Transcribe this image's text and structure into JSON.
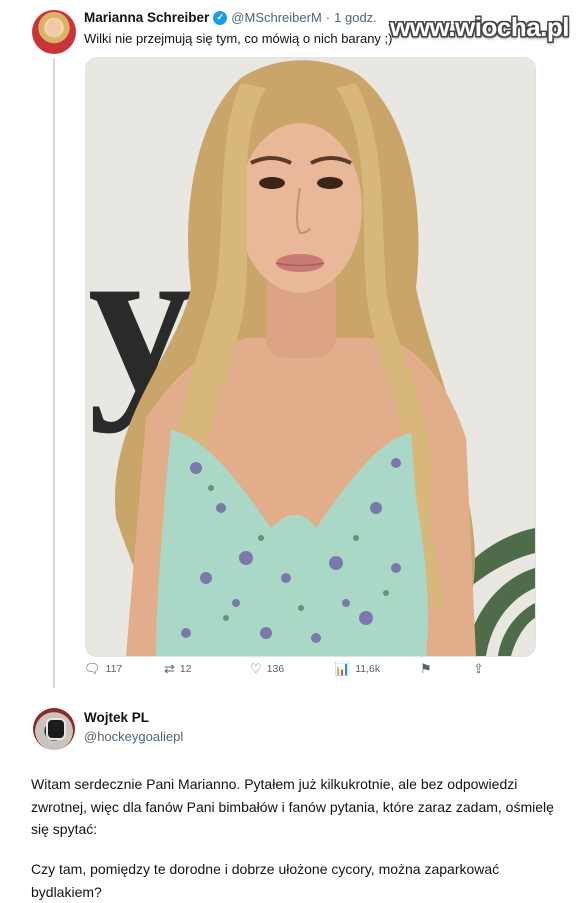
{
  "tweet": {
    "author_name": "Marianna Schreiber",
    "author_handle": "@MSchreiberM",
    "separator": "·",
    "time": "1 godz.",
    "text": "Wilki nie przejmują się tym, co mówią o nich barany ;)",
    "photo_text": "yl",
    "actions": {
      "replies": "117",
      "retweets": "12",
      "likes": "136",
      "views": "11,6k"
    }
  },
  "watermark": "www.wiocha.pl",
  "reply": {
    "author_name": "Wojtek PL",
    "author_handle": "@hockeygoaliepl",
    "paragraph_1": "Witam serdecznie Pani Marianno. Pytałem już kilkukrotnie, ale bez odpowiedzi zwrotnej, więc dla fanów Pani bimbałów i fanów pytania, które zaraz zadam, ośmielę się spytać:",
    "paragraph_2": "Czy tam, pomiędzy te dorodne i dobrze ułożone cycory, można zaparkować bydlakiem?"
  },
  "colors": {
    "verified": "#1d9bf0",
    "muted_text": "#536471",
    "dress": "#a9d9c6",
    "hair": "#c9a56a"
  },
  "icons": [
    "reply-icon",
    "retweet-icon",
    "like-icon",
    "views-icon",
    "bookmark-icon",
    "share-icon",
    "verified-badge-icon"
  ]
}
